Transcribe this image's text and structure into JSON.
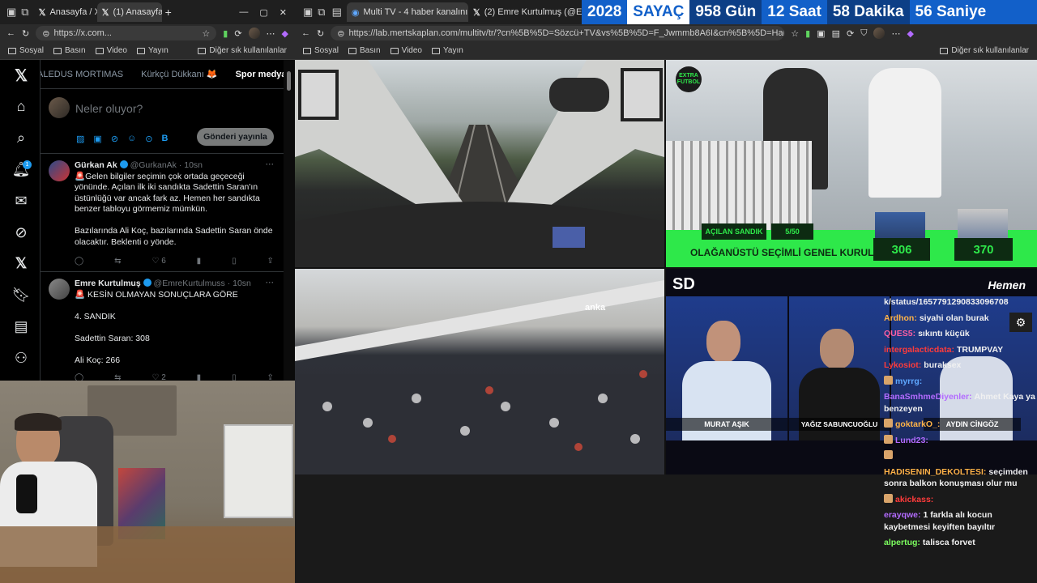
{
  "left_browser": {
    "tabs": [
      {
        "label": "Anasayfa / X"
      },
      {
        "label": "(1) Anasayfa / X"
      }
    ],
    "url": "https://x.com...",
    "bookmarks": [
      "Sosyal",
      "Basın",
      "Video",
      "Yayın"
    ],
    "other_bookmarks": "Diğer sık kullanılanlar"
  },
  "x": {
    "notif_count": "1",
    "list_tabs": [
      "ALEDUS MORTIMAS",
      "Kürkçü Dükkanı 🦊",
      "Spor medyası"
    ],
    "compose_placeholder": "Neler oluyor?",
    "post_button": "Gönderi yayınla",
    "tweets": [
      {
        "name": "Gürkan Ak",
        "handle": "@GurkanAk · 10sn",
        "text": "🚨Gelen bilgiler seçimin çok ortada geçeceği yönünde. Açılan ilk iki sandıkta Sadettin Saran'ın üstünlüğü var ancak fark az. Hemen her sandıkta benzer tabloyu görmemiz mümkün.\n\nBazılarında Ali Koç, bazılarında Sadettin Saran önde olacaktır. Beklenti o yönde.",
        "likes": "6"
      },
      {
        "name": "Emre Kurtulmuş",
        "handle": "@EmreKurtulmuss · 10sn",
        "text": "🚨 KESİN OLMAYAN SONUÇLARA GÖRE\n\n4. SANDIK\n\nSadettin Saran: 308\n\nAli Koç: 266",
        "likes": "2"
      }
    ]
  },
  "right_browser": {
    "tabs": [
      {
        "label": "Multi TV - 4 haber kanalını a..."
      },
      {
        "label": "(2) Emre Kurtulmuş (@EmreKurtu..."
      }
    ],
    "url": "https://lab.mertskaplan.com/multitv/tr/?cn%5B%5D=Sözcü+TV&vs%5B%5D=F_Jwmmb8A6I&cn%5B%5D=Halk+TV&...",
    "bookmarks": [
      "Sosyal",
      "Basın",
      "Video",
      "Yayın"
    ],
    "other_bookmarks": "Diğer sık kullanılanlar"
  },
  "counter": {
    "year": "2028",
    "label": "SAYAÇ",
    "days": "958 Gün",
    "hours": "12 Saat",
    "minutes": "58 Dakika",
    "seconds": "56 Saniye"
  },
  "tv": {
    "sport_channel": "EXTRA FUTBOL",
    "acilan_sandik": "AÇILAN SANDIK",
    "sandik_count": "5/50",
    "headline": "OLAĞANÜSTÜ SEÇİMLİ GENEL KURUL",
    "score_left": "306",
    "score_right": "370",
    "stadium_logo": "anka",
    "sd_logo": "SD",
    "hemen_logo": "Hemen",
    "names": [
      "MURAT AŞIK",
      "YAĞIZ SABUNCUOĞLU",
      "AYDIN CİNGÖZ"
    ]
  },
  "chat": [
    {
      "user": "",
      "text": "k/status/1657791290833096708",
      "color": "#ffffff"
    },
    {
      "user": "Ardhon:",
      "text": "siyahi olan burak",
      "color": "#ffb347"
    },
    {
      "user": "QUES5:",
      "text": "sıkıntı küçük",
      "color": "#ff5fa2"
    },
    {
      "user": "intergalacticdata:",
      "text": "TRUMPVAY",
      "color": "#ff3b3b"
    },
    {
      "user": "Lykosiot:",
      "text": "buraksex",
      "color": "#ff3b3b"
    },
    {
      "user": "myrrg:",
      "text": "",
      "color": "#5fa8ff"
    },
    {
      "user": "BanaSmhmeDiyenler:",
      "text": "Ahmet Kaya ya benzeyen",
      "color": "#b36bff"
    },
    {
      "user": "goktarkO_:",
      "text": "",
      "color": "#ffb347"
    },
    {
      "user": "Lund23:",
      "text": "",
      "color": "#b36bff"
    },
    {
      "user": "",
      "text": "",
      "color": "#ffffff"
    },
    {
      "user": "HADISENIN_DEKOLTESI:",
      "text": "seçimden sonra balkon konuşması olur mu",
      "color": "#ffb347"
    },
    {
      "user": "akickass:",
      "text": "",
      "color": "#ff3b3b"
    },
    {
      "user": "erayqwe:",
      "text": "1 farkla alı kocun kaybetmesi keyiften bayıltır",
      "color": "#b36bff"
    },
    {
      "user": "alpertug:",
      "text": "talisca forvet",
      "color": "#7cff5f"
    }
  ],
  "colors": {
    "x_blue": "#1d9bf0",
    "counter_blue": "#1260c9",
    "tv_green": "#2ee84a"
  }
}
